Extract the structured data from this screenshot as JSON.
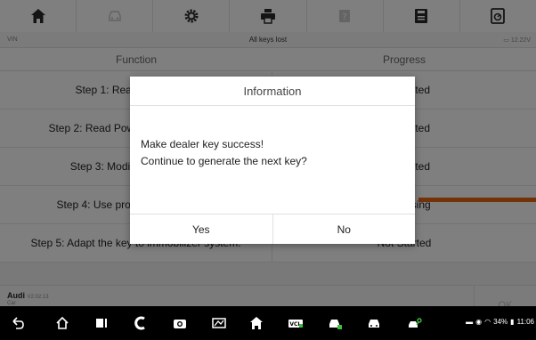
{
  "toolbar": {
    "items": [
      {
        "icon": "home-icon",
        "enabled": true
      },
      {
        "icon": "vehicle-icon",
        "enabled": false
      },
      {
        "icon": "settings-gear-icon",
        "enabled": true
      },
      {
        "icon": "print-icon",
        "enabled": true
      },
      {
        "icon": "help-icon",
        "enabled": false
      },
      {
        "icon": "save-icon",
        "enabled": true
      },
      {
        "icon": "datalogging-icon",
        "enabled": true
      }
    ]
  },
  "infobar": {
    "vin": "VIN",
    "mode": "All keys lost",
    "voltage": "12.22V"
  },
  "table": {
    "headers": [
      "Function",
      "Progress"
    ],
    "rows": [
      {
        "function": "Step 1: Read IMMO data.",
        "progress": "Completed"
      },
      {
        "function": "Step 2: Read PowerClass EEPROM.",
        "progress": "Completed"
      },
      {
        "function": "Step 3: Modify vehicle data.",
        "progress": "Completed"
      },
      {
        "function": "Step 4: Use programming device.",
        "progress": "Processing"
      },
      {
        "function": "Step 5: Adapt the key to immobilizer system.",
        "progress": "Not Started"
      }
    ]
  },
  "footer": {
    "brand": "Audi",
    "version": "V2.02.13",
    "sub": "Car",
    "ok_label": "OK"
  },
  "dialog": {
    "title": "Information",
    "message_line1": "Make dealer key success!",
    "message_line2": "Continue to generate the next key?",
    "yes_label": "Yes",
    "no_label": "No"
  },
  "statusbar": {
    "battery": "34%",
    "time": "11:06"
  },
  "colors": {
    "accent_orange": "#e86412",
    "overlay": "#000000"
  }
}
